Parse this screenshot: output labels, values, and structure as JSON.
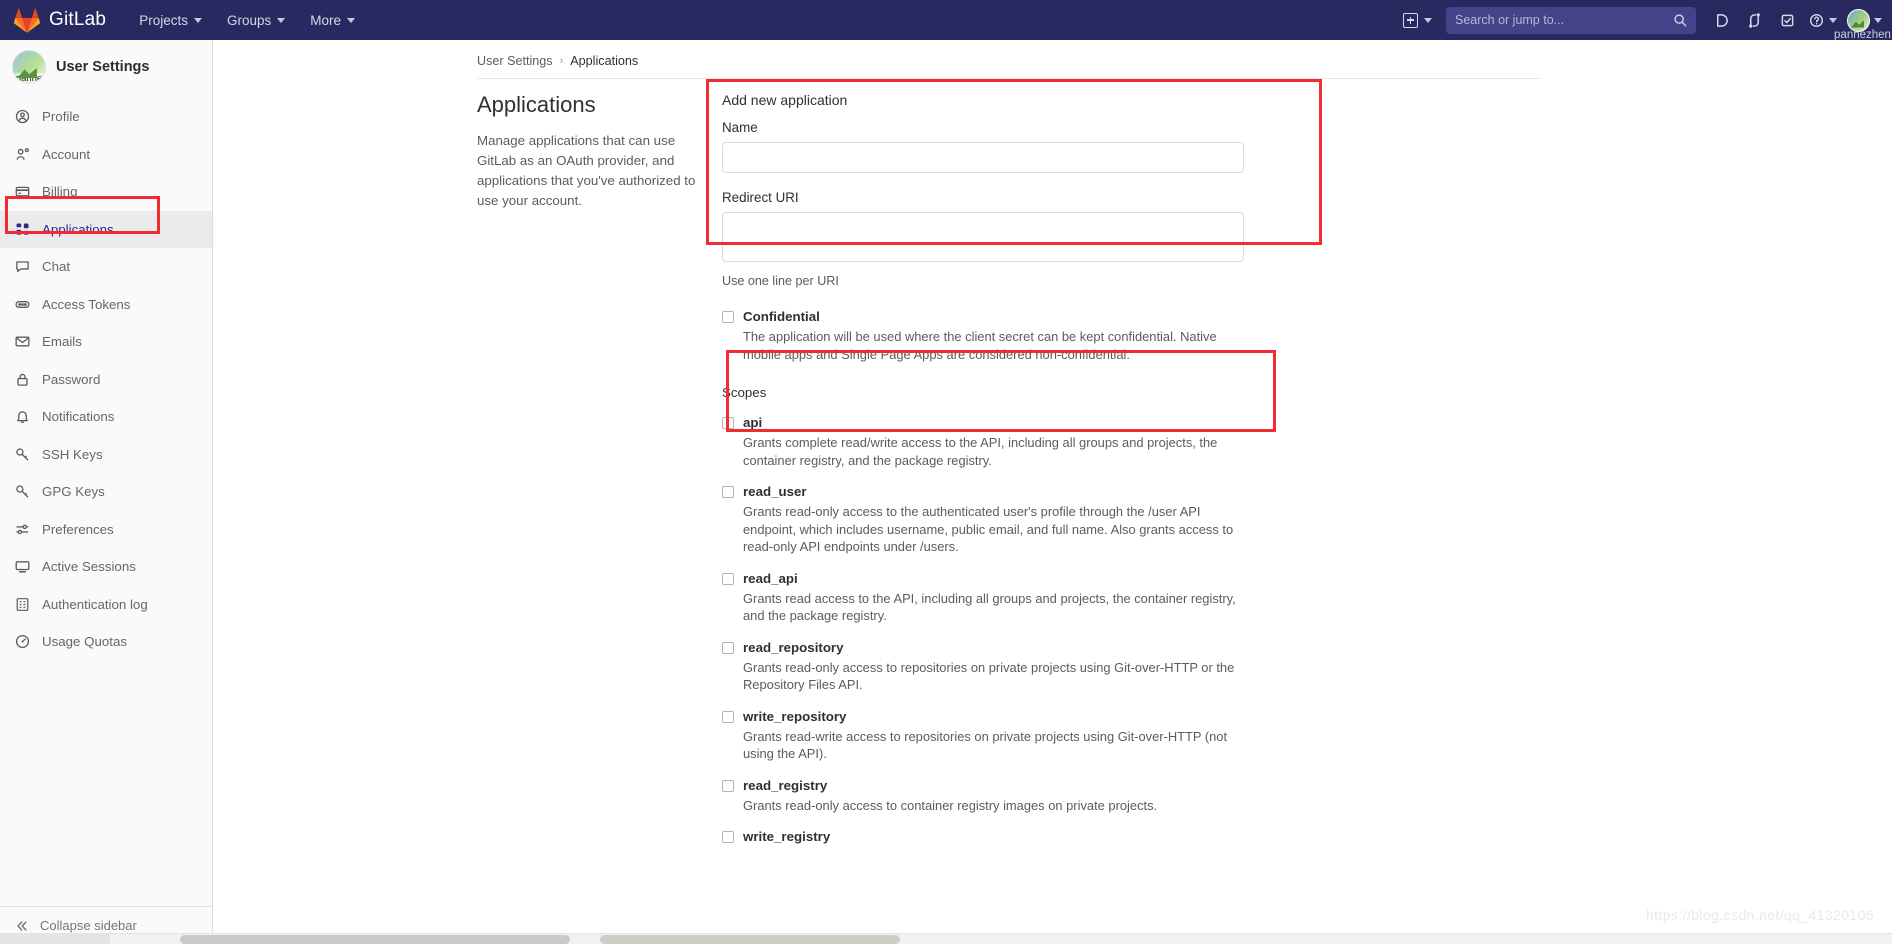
{
  "navbar": {
    "brand": "GitLab",
    "brand_icon": "gitlab-tanuki-logo",
    "menu": [
      {
        "label": "Projects",
        "icon": "chevron-down-icon"
      },
      {
        "label": "Groups",
        "icon": "chevron-down-icon"
      },
      {
        "label": "More",
        "icon": "chevron-down-icon"
      }
    ],
    "create_new": {
      "icon": "plus-square-icon",
      "label": ""
    },
    "search": {
      "placeholder": "Search or jump to...",
      "value": "",
      "icon": "search-icon"
    },
    "icons": [
      {
        "name": "issues-icon",
        "glyph": "D"
      },
      {
        "name": "merge-requests-icon",
        "glyph": "⎇"
      },
      {
        "name": "todos-icon",
        "glyph": "☑"
      },
      {
        "name": "help-icon",
        "glyph": "?"
      }
    ],
    "user": {
      "name": "panhezhen",
      "avatar": "user-avatar-image"
    }
  },
  "sidebar": {
    "title": "User Settings",
    "avatar_label": "panhe",
    "items": [
      {
        "label": "Profile",
        "icon": "user-circle-icon",
        "active": false
      },
      {
        "label": "Account",
        "icon": "account-gear-icon",
        "active": false
      },
      {
        "label": "Billing",
        "icon": "credit-card-icon",
        "active": false
      },
      {
        "label": "Applications",
        "icon": "applications-grid-icon",
        "active": true
      },
      {
        "label": "Chat",
        "icon": "chat-bubble-icon",
        "active": false
      },
      {
        "label": "Access Tokens",
        "icon": "token-pill-icon",
        "active": false
      },
      {
        "label": "Emails",
        "icon": "envelope-icon",
        "active": false
      },
      {
        "label": "Password",
        "icon": "lock-icon",
        "active": false
      },
      {
        "label": "Notifications",
        "icon": "bell-icon",
        "active": false
      },
      {
        "label": "SSH Keys",
        "icon": "key-icon",
        "active": false
      },
      {
        "label": "GPG Keys",
        "icon": "key-icon",
        "active": false
      },
      {
        "label": "Preferences",
        "icon": "sliders-icon",
        "active": false
      },
      {
        "label": "Active Sessions",
        "icon": "monitor-icon",
        "active": false
      },
      {
        "label": "Authentication log",
        "icon": "list-grid-icon",
        "active": false
      },
      {
        "label": "Usage Quotas",
        "icon": "quota-meter-icon",
        "active": false
      }
    ],
    "collapse": {
      "label": "Collapse sidebar",
      "icon": "double-chevron-left-icon"
    }
  },
  "breadcrumb": {
    "parent": "User Settings",
    "separator": "›",
    "current": "Applications"
  },
  "main": {
    "title": "Applications",
    "description": "Manage applications that can use GitLab as an OAuth provider, and applications that you've authorized to use your account.",
    "form": {
      "heading": "Add new application",
      "name": {
        "label": "Name",
        "value": "",
        "placeholder": ""
      },
      "redirect_uri": {
        "label": "Redirect URI",
        "value": "",
        "placeholder": "",
        "helper": "Use one line per URI"
      },
      "confidential": {
        "label": "Confidential",
        "checked": false,
        "description": "The application will be used where the client secret can be kept confidential. Native mobile apps and Single Page Apps are considered non-confidential."
      },
      "scopes_label": "Scopes",
      "scopes": [
        {
          "name": "api",
          "checked": false,
          "description": "Grants complete read/write access to the API, including all groups and projects, the container registry, and the package registry."
        },
        {
          "name": "read_user",
          "checked": false,
          "description": "Grants read-only access to the authenticated user's profile through the /user API endpoint, which includes username, public email, and full name. Also grants access to read-only API endpoints under /users."
        },
        {
          "name": "read_api",
          "checked": false,
          "description": "Grants read access to the API, including all groups and projects, the container registry, and the package registry."
        },
        {
          "name": "read_repository",
          "checked": false,
          "description": "Grants read-only access to repositories on private projects using Git-over-HTTP or the Repository Files API."
        },
        {
          "name": "write_repository",
          "checked": false,
          "description": "Grants read-write access to repositories on private projects using Git-over-HTTP (not using the API)."
        },
        {
          "name": "read_registry",
          "checked": false,
          "description": "Grants read-only access to container registry images on private projects."
        },
        {
          "name": "write_registry",
          "checked": false,
          "description": ""
        }
      ]
    }
  },
  "watermark": "https://blog.csdn.net/qq_41320105",
  "colors": {
    "navbar_bg": "#292961",
    "annotation_red": "#f42a32",
    "sidebar_bg": "#fafafa",
    "active_item_text": "#2b2b8c",
    "link_text": "#1068bf"
  }
}
